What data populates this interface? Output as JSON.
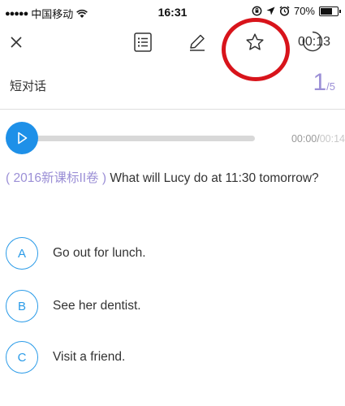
{
  "status_bar": {
    "signal_dots": "●●●●●",
    "carrier": "中国移动",
    "time": "16:31",
    "battery": "70%"
  },
  "toolbar": {
    "icons": [
      "close-icon",
      "answer-sheet-icon",
      "edit-icon",
      "star-icon"
    ],
    "timer": "00:13"
  },
  "header": {
    "section_label": "短对话",
    "page_current": "1",
    "page_total": "/5"
  },
  "audio": {
    "current_time": "00:00",
    "separator": "/",
    "total_time": "00:14",
    "progress": 0
  },
  "question": {
    "source": "( 2016新课标II卷 )",
    "text": "What will Lucy do at 11:30 tomorrow?"
  },
  "options": [
    {
      "letter": "A",
      "text": "Go out for lunch."
    },
    {
      "letter": "B",
      "text": "See her dentist."
    },
    {
      "letter": "C",
      "text": "Visit a friend."
    }
  ],
  "colors": {
    "accent_blue": "#1e90e8",
    "option_blue": "#2a9be8",
    "purple": "#9b8fd6",
    "annotation_red": "#d8141b"
  }
}
